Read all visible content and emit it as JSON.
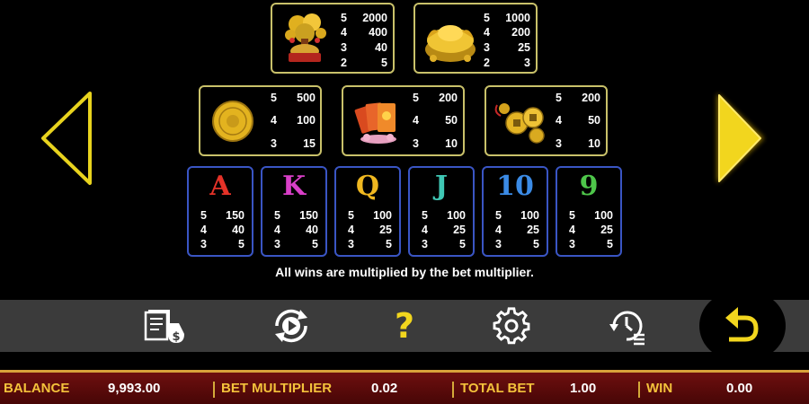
{
  "nav": {
    "prev_icon": "chevron-left-icon",
    "next_icon": "chevron-right-icon",
    "color": "#e8d31e"
  },
  "paytable": {
    "premium": [
      {
        "symbol": "money-tree-icon",
        "pays": [
          {
            "count": "5",
            "value": "2000"
          },
          {
            "count": "4",
            "value": "400"
          },
          {
            "count": "3",
            "value": "40"
          },
          {
            "count": "2",
            "value": "5"
          }
        ]
      },
      {
        "symbol": "gold-ingot-icon",
        "pays": [
          {
            "count": "5",
            "value": "1000"
          },
          {
            "count": "4",
            "value": "200"
          },
          {
            "count": "3",
            "value": "25"
          },
          {
            "count": "2",
            "value": "3"
          }
        ]
      }
    ],
    "mid": [
      {
        "symbol": "gold-coin-icon",
        "pays": [
          {
            "count": "5",
            "value": "500"
          },
          {
            "count": "4",
            "value": "100"
          },
          {
            "count": "3",
            "value": "15"
          }
        ]
      },
      {
        "symbol": "red-envelopes-icon",
        "pays": [
          {
            "count": "5",
            "value": "200"
          },
          {
            "count": "4",
            "value": "50"
          },
          {
            "count": "3",
            "value": "10"
          }
        ]
      },
      {
        "symbol": "lucky-coins-icon",
        "pays": [
          {
            "count": "5",
            "value": "200"
          },
          {
            "count": "4",
            "value": "50"
          },
          {
            "count": "3",
            "value": "10"
          }
        ]
      }
    ],
    "low": [
      {
        "letter": "A",
        "color": "#e53228",
        "pays": [
          {
            "count": "5",
            "value": "150"
          },
          {
            "count": "4",
            "value": "40"
          },
          {
            "count": "3",
            "value": "5"
          }
        ]
      },
      {
        "letter": "K",
        "color": "#d93fc8",
        "pays": [
          {
            "count": "5",
            "value": "150"
          },
          {
            "count": "4",
            "value": "40"
          },
          {
            "count": "3",
            "value": "5"
          }
        ]
      },
      {
        "letter": "Q",
        "color": "#f0b820",
        "pays": [
          {
            "count": "5",
            "value": "100"
          },
          {
            "count": "4",
            "value": "25"
          },
          {
            "count": "3",
            "value": "5"
          }
        ]
      },
      {
        "letter": "J",
        "color": "#3fc7b4",
        "pays": [
          {
            "count": "5",
            "value": "100"
          },
          {
            "count": "4",
            "value": "25"
          },
          {
            "count": "3",
            "value": "5"
          }
        ]
      },
      {
        "letter": "10",
        "color": "#3b8be6",
        "pays": [
          {
            "count": "5",
            "value": "100"
          },
          {
            "count": "4",
            "value": "25"
          },
          {
            "count": "3",
            "value": "5"
          }
        ]
      },
      {
        "letter": "9",
        "color": "#4ec64a",
        "pays": [
          {
            "count": "5",
            "value": "100"
          },
          {
            "count": "4",
            "value": "25"
          },
          {
            "count": "3",
            "value": "5"
          }
        ]
      }
    ]
  },
  "note": "All wins are multiplied by the bet multiplier.",
  "toolbar": {
    "paytable_icon": "paytable-icon",
    "autoplay_icon": "autoplay-icon",
    "help_label": "?",
    "settings_icon": "gear-icon",
    "history_icon": "history-icon",
    "back_icon": "back-arrow-icon"
  },
  "status": {
    "balance_label": "BALANCE",
    "balance_value": "9,993.00",
    "bet_multiplier_label": "BET MULTIPLIER",
    "bet_multiplier_value": "0.02",
    "total_bet_label": "TOTAL BET",
    "total_bet_value": "1.00",
    "win_label": "WIN",
    "win_value": "0.00"
  },
  "colors": {
    "gold_border": "#c9c16a",
    "blue_border": "#3a55c4",
    "status_label": "#f4c23b",
    "accent_yellow": "#f2d61e"
  }
}
